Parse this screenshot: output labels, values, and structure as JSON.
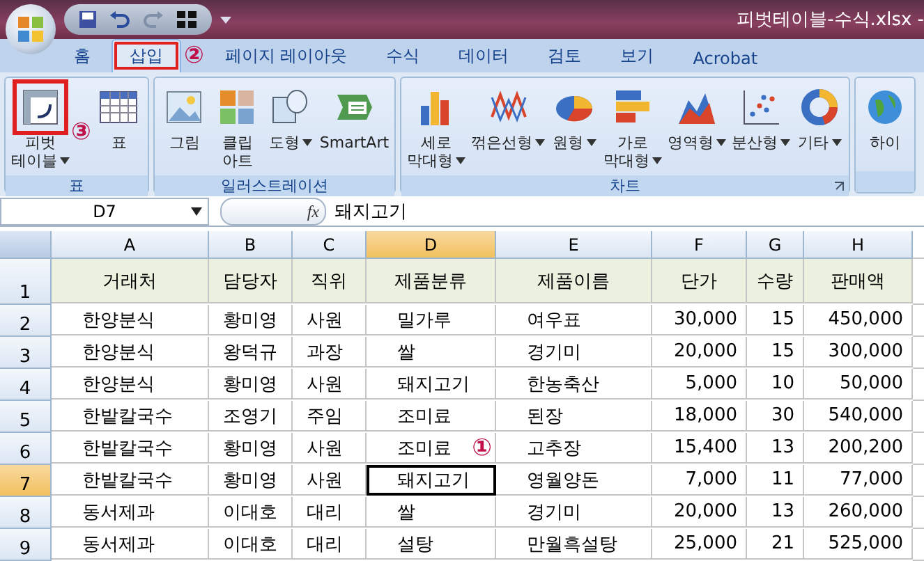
{
  "title_bar": {
    "title": "피벗테이블-수식.xlsx -"
  },
  "tabs": [
    {
      "label": "홈",
      "selected": false,
      "highlighted": false
    },
    {
      "label": "삽입",
      "selected": true,
      "highlighted": true,
      "annotation": "②"
    },
    {
      "label": "페이지 레이아웃",
      "selected": false,
      "highlighted": false
    },
    {
      "label": "수식",
      "selected": false,
      "highlighted": false
    },
    {
      "label": "데이터",
      "selected": false,
      "highlighted": false
    },
    {
      "label": "검토",
      "selected": false,
      "highlighted": false
    },
    {
      "label": "보기",
      "selected": false,
      "highlighted": false
    },
    {
      "label": "Acrobat",
      "selected": false,
      "highlighted": false
    }
  ],
  "ribbon": {
    "groups": [
      {
        "label": "표",
        "buttons": [
          {
            "label": "피벗\n테이블",
            "dropdown": true,
            "highlighted": true,
            "annotation": "③"
          },
          {
            "label": "표",
            "dropdown": false,
            "highlighted": false
          }
        ]
      },
      {
        "label": "일러스트레이션",
        "buttons": [
          {
            "label": "그림",
            "dropdown": false,
            "highlighted": false
          },
          {
            "label": "클립\n아트",
            "dropdown": false,
            "highlighted": false
          },
          {
            "label": "도형",
            "dropdown": true,
            "highlighted": false
          },
          {
            "label": "SmartArt",
            "dropdown": false,
            "highlighted": false
          }
        ]
      },
      {
        "label": "차트",
        "launcher": true,
        "buttons": [
          {
            "label": "세로\n막대형",
            "dropdown": true,
            "highlighted": false
          },
          {
            "label": "꺾은선형",
            "dropdown": true,
            "highlighted": false
          },
          {
            "label": "원형",
            "dropdown": true,
            "highlighted": false
          },
          {
            "label": "가로\n막대형",
            "dropdown": true,
            "highlighted": false
          },
          {
            "label": "영역형",
            "dropdown": true,
            "highlighted": false
          },
          {
            "label": "분산형",
            "dropdown": true,
            "highlighted": false
          },
          {
            "label": "기타",
            "dropdown": true,
            "highlighted": false
          }
        ]
      },
      {
        "buttons": [
          {
            "label": "하이",
            "dropdown": false,
            "highlighted": false
          }
        ]
      }
    ]
  },
  "formula_bar": {
    "name_box": "D7",
    "function_label": "fx",
    "value": "돼지고기"
  },
  "sheet": {
    "columns": [
      {
        "label": "A",
        "selected": false
      },
      {
        "label": "B",
        "selected": false
      },
      {
        "label": "C",
        "selected": false
      },
      {
        "label": "D",
        "selected": true
      },
      {
        "label": "E",
        "selected": false
      },
      {
        "label": "F",
        "selected": false
      },
      {
        "label": "G",
        "selected": false
      },
      {
        "label": "H",
        "selected": false
      }
    ],
    "rows": [
      {
        "label": "1",
        "kind": "header",
        "selected": false,
        "cells": [
          "거래처",
          "담당자",
          "직위",
          "제품분류",
          "제품이름",
          "단가",
          "수량",
          "판매액"
        ]
      },
      {
        "label": "2",
        "kind": "data",
        "selected": false,
        "cells": [
          "한양분식",
          "황미영",
          "사원",
          "밀가루",
          "여우표",
          "30,000",
          "15",
          "450,000"
        ]
      },
      {
        "label": "3",
        "kind": "data",
        "selected": false,
        "cells": [
          "한양분식",
          "왕덕규",
          "과장",
          "쌀",
          "경기미",
          "20,000",
          "15",
          "300,000"
        ]
      },
      {
        "label": "4",
        "kind": "data",
        "selected": false,
        "cells": [
          "한양분식",
          "황미영",
          "사원",
          "돼지고기",
          "한농축산",
          "5,000",
          "10",
          "50,000"
        ]
      },
      {
        "label": "5",
        "kind": "data",
        "selected": false,
        "cells": [
          "한밭칼국수",
          "조영기",
          "주임",
          "조미료",
          "된장",
          "18,000",
          "30",
          "540,000"
        ]
      },
      {
        "label": "6",
        "kind": "data",
        "selected": false,
        "annotation": "①",
        "cells": [
          "한밭칼국수",
          "황미영",
          "사원",
          "조미료",
          "고추장",
          "15,400",
          "13",
          "200,200"
        ]
      },
      {
        "label": "7",
        "kind": "data",
        "selected": true,
        "cells": [
          "한밭칼국수",
          "황미영",
          "사원",
          "돼지고기",
          "영월양돈",
          "7,000",
          "11",
          "77,000"
        ]
      },
      {
        "label": "8",
        "kind": "data",
        "selected": false,
        "cells": [
          "동서제과",
          "이대호",
          "대리",
          "쌀",
          "경기미",
          "20,000",
          "13",
          "260,000"
        ]
      },
      {
        "label": "9",
        "kind": "data",
        "selected": false,
        "cells": [
          "동서제과",
          "이대호",
          "대리",
          "설탕",
          "만월흑설탕",
          "25,000",
          "21",
          "525,000"
        ]
      }
    ]
  }
}
